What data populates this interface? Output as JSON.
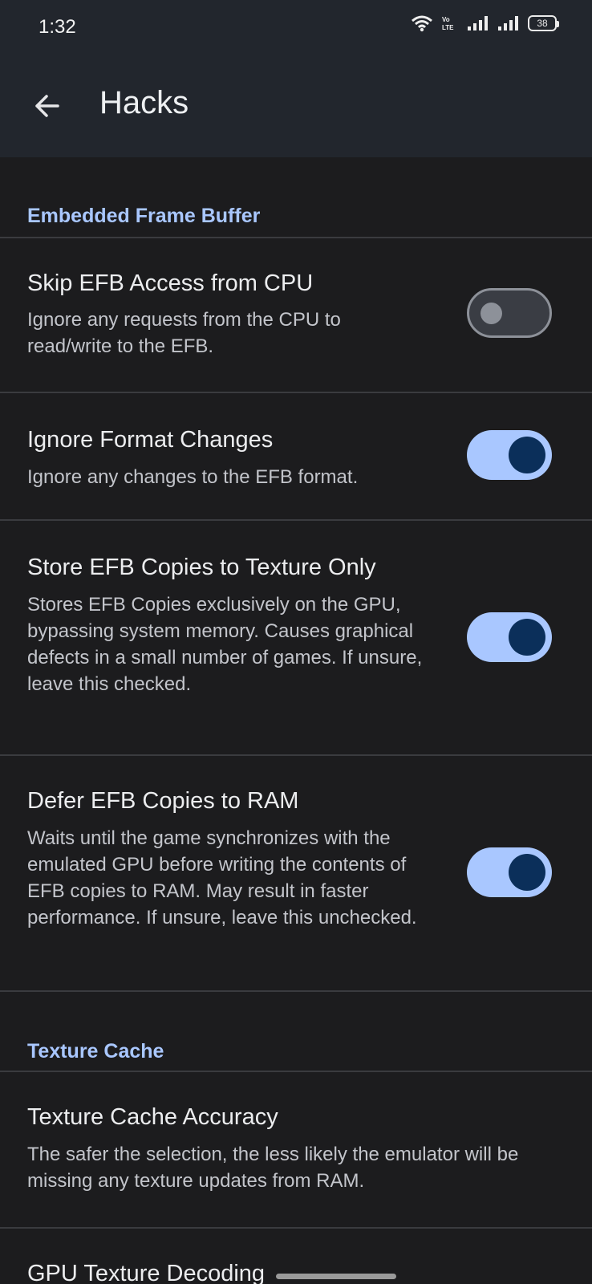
{
  "status": {
    "time": "1:32",
    "network_label": "VoLTE",
    "battery": "38"
  },
  "appbar": {
    "title": "Hacks"
  },
  "sections": [
    {
      "header": "Embedded Frame Buffer"
    },
    {
      "header": "Texture Cache"
    }
  ],
  "prefs": [
    {
      "title": "Skip EFB Access from CPU",
      "summary": "Ignore any requests from the CPU to read/write to the EFB.",
      "checked": false
    },
    {
      "title": "Ignore Format Changes",
      "summary": "Ignore any changes to the EFB format.",
      "checked": true
    },
    {
      "title": "Store EFB Copies to Texture Only",
      "summary": "Stores EFB Copies exclusively on the GPU, bypassing system memory. Causes graphical defects in a small number of games. If unsure, leave this checked.",
      "checked": true
    },
    {
      "title": "Defer EFB Copies to RAM",
      "summary": "Waits until the game synchronizes with the emulated GPU before writing the contents of EFB copies to RAM. May result in faster performance. If unsure, leave this unchecked.",
      "checked": true
    },
    {
      "title": "Texture Cache Accuracy",
      "summary": "The safer the selection, the less likely the emulator will be missing any texture updates from RAM."
    },
    {
      "title": "GPU Texture Decoding"
    }
  ],
  "colors": {
    "accent": "#a9c7ff",
    "background": "#1c1c1e",
    "appbar": "#22262d"
  }
}
